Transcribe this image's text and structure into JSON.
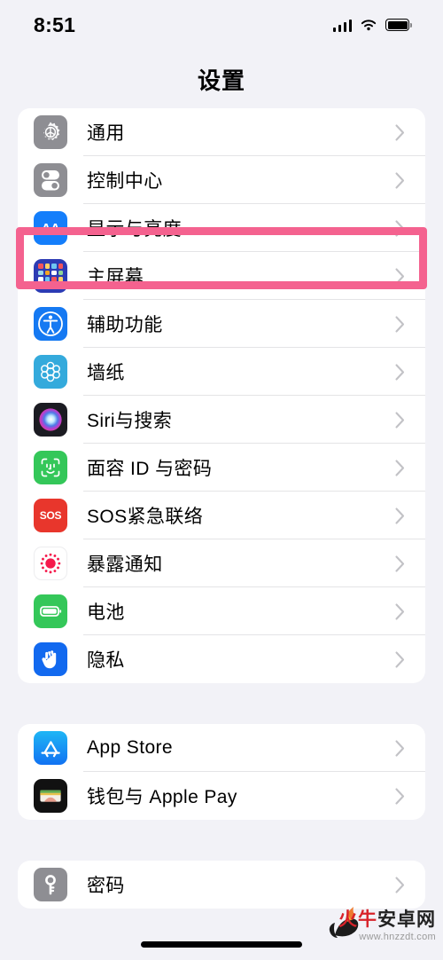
{
  "status_bar": {
    "time": "8:51",
    "signal_icon": "cellular-signal-icon",
    "wifi_icon": "wifi-icon",
    "battery_icon": "battery-full-icon"
  },
  "nav": {
    "title": "设置"
  },
  "highlight": {
    "color": "#F4628F",
    "target_row": "显示与亮度"
  },
  "groups": [
    {
      "rows": [
        {
          "label": "通用",
          "icon": "gear-icon",
          "icon_bg": "#8E8E93",
          "chevron": "›"
        },
        {
          "label": "控制中心",
          "icon": "toggles-icon",
          "icon_bg": "#8E8E93",
          "chevron": "›"
        },
        {
          "label": "显示与亮度",
          "icon": "aa-text-icon",
          "icon_bg": "#147EFB",
          "chevron": "›"
        },
        {
          "label": "主屏幕",
          "icon": "app-grid-icon",
          "icon_bg": "#2C3BB4",
          "chevron": "›"
        },
        {
          "label": "辅助功能",
          "icon": "accessibility-icon",
          "icon_bg": "#1579F2",
          "chevron": "›"
        },
        {
          "label": "墙纸",
          "icon": "wallpaper-icon",
          "icon_bg": "#34AADC",
          "chevron": "›"
        },
        {
          "label": "Siri与搜索",
          "icon": "siri-orb-icon",
          "icon_bg": "#1B1B22",
          "chevron": "›"
        },
        {
          "label": "面容 ID 与密码",
          "icon": "face-id-icon",
          "icon_bg": "#34C759",
          "chevron": "›"
        },
        {
          "label": "SOS紧急联络",
          "icon": "sos-icon",
          "icon_bg": "#E8362C",
          "chevron": "›"
        },
        {
          "label": "暴露通知",
          "icon": "exposure-notification-icon",
          "icon_bg": "#FFFFFF",
          "chevron": "›"
        },
        {
          "label": "电池",
          "icon": "battery-icon",
          "icon_bg": "#34C759",
          "chevron": "›"
        },
        {
          "label": "隐私",
          "icon": "hand-privacy-icon",
          "icon_bg": "#1269EF",
          "chevron": "›"
        }
      ]
    },
    {
      "rows": [
        {
          "label": "App Store",
          "icon": "app-store-icon",
          "icon_bg": "#1A9AF5",
          "chevron": "›"
        },
        {
          "label": "钱包与 Apple Pay",
          "icon": "wallet-icon",
          "icon_bg": "#111111",
          "chevron": "›"
        }
      ]
    },
    {
      "rows": [
        {
          "label": "密码",
          "icon": "key-icon",
          "icon_bg": "#8E8E93",
          "chevron": "›"
        }
      ]
    }
  ],
  "watermark": {
    "brand_red": "火牛",
    "brand_black": "安卓网",
    "url": "www.hnzzdt.com"
  }
}
